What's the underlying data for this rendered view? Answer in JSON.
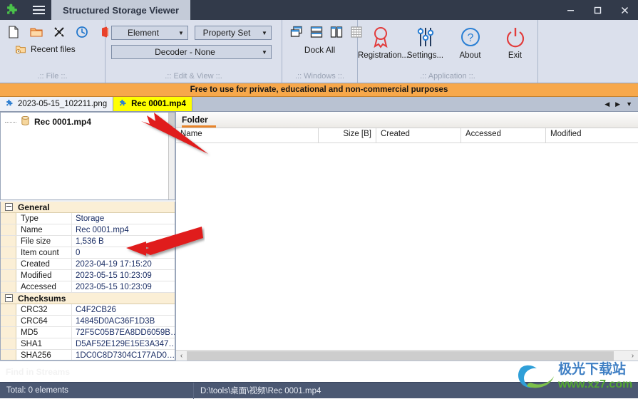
{
  "window": {
    "title": "Structured Storage Viewer",
    "logo_icon": "green-puzzle-icon",
    "menu_icon": "hamburger-icon",
    "minimize_label": "—",
    "maximize_label": "□",
    "close_label": "✕"
  },
  "ribbon": {
    "groups": [
      {
        "key": "file",
        "label": ".:: File ::.",
        "icons": [
          "new-file-icon",
          "open-folder-icon",
          "close-file-icon",
          "refresh-icon",
          "office-file-icon"
        ],
        "recent_label": "Recent files",
        "recent_icon": "recent-files-icon"
      },
      {
        "key": "edit",
        "label": ".:: Edit & View ::.",
        "combos": [
          {
            "name": "element-combo",
            "value": "Element"
          },
          {
            "name": "property-set-combo",
            "value": "Property Set"
          },
          {
            "name": "decoder-combo",
            "value": "Decoder - None"
          }
        ]
      },
      {
        "key": "windows",
        "label": ".:: Windows ::.",
        "icons": [
          "cascade-windows-icon",
          "tile-horizontal-icon",
          "tile-vertical-icon",
          "grid-arrange-icon"
        ],
        "dock_label": "Dock All"
      },
      {
        "key": "application",
        "label": ".:: Application ::.",
        "items": [
          {
            "name": "registration-button",
            "label": "Registration...",
            "icon": "award-ribbon-icon"
          },
          {
            "name": "settings-button",
            "label": "Settings...",
            "icon": "sliders-icon"
          },
          {
            "name": "about-button",
            "label": "About",
            "icon": "question-circle-icon"
          },
          {
            "name": "exit-button",
            "label": "Exit",
            "icon": "power-icon"
          }
        ]
      }
    ]
  },
  "banner": {
    "text": "Free to use for private, educational and non-commercial  purposes"
  },
  "tabs": {
    "items": [
      {
        "label": "2023-05-15_102211.png",
        "active": false,
        "icon": "puzzle-icon"
      },
      {
        "label": "Rec 0001.mp4",
        "active": true,
        "icon": "puzzle-icon"
      }
    ],
    "nav": {
      "prev": "◀",
      "next": "▶",
      "list": "▼"
    }
  },
  "tree": {
    "root": {
      "label": "Rec 0001.mp4",
      "icon": "storage-cylinder-icon"
    }
  },
  "properties": {
    "sections": [
      {
        "name": "General",
        "rows": [
          {
            "key": "Type",
            "value": "Storage"
          },
          {
            "key": "Name",
            "value": "Rec 0001.mp4"
          },
          {
            "key": "File size",
            "value": "1,536 B"
          },
          {
            "key": "Item count",
            "value": "0"
          },
          {
            "key": "Created",
            "value": "2023-04-19 17:15:20"
          },
          {
            "key": "Modified",
            "value": "2023-05-15 10:23:09"
          },
          {
            "key": "Accessed",
            "value": "2023-05-15 10:23:09"
          }
        ]
      },
      {
        "name": "Checksums",
        "rows": [
          {
            "key": "CRC32",
            "value": "C4F2CB26"
          },
          {
            "key": "CRC64",
            "value": "14845D0AC36F1D3B"
          },
          {
            "key": "MD5",
            "value": "72F5C05B7EA8DD6059B…"
          },
          {
            "key": "SHA1",
            "value": "D5AF52E129E15E3A347…"
          },
          {
            "key": "SHA256",
            "value": "1DC0C8D7304C177AD0…"
          }
        ]
      }
    ]
  },
  "folder_panel": {
    "title": "Folder",
    "columns": [
      "Name",
      "Size [B]",
      "Created",
      "Accessed",
      "Modified"
    ],
    "rows": []
  },
  "find_bar": {
    "placeholder": "Find in Streams"
  },
  "status_bar": {
    "total": "Total: 0 elements",
    "path": "D:\\tools\\桌面\\视频\\Rec 0001.mp4"
  },
  "watermark": {
    "text_cn": "极光下载站",
    "text_url": "www.xz7.com"
  },
  "colors": {
    "titlebar": "#323a4a",
    "ribbon": "#dbe0ec",
    "banner": "#f7a84b",
    "active_tab": "#ffff00",
    "status_bar": "#4b5872",
    "accent_orange": "#e8842a",
    "value_text": "#1c2f66",
    "section_bg": "#fbefd6",
    "arrow_red": "#e01b1b"
  }
}
